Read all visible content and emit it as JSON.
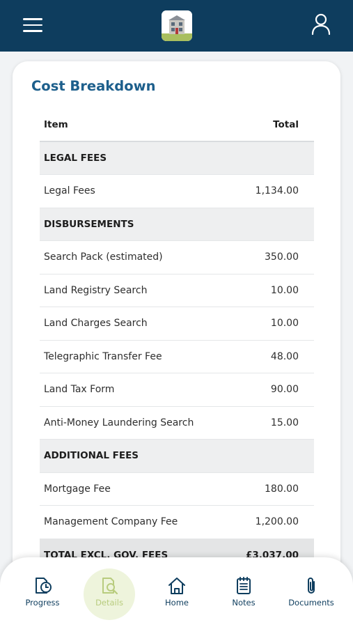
{
  "card": {
    "title": "Cost Breakdown"
  },
  "table": {
    "header": {
      "item": "Item",
      "total": "Total"
    },
    "rows": [
      {
        "type": "section",
        "label": "LEGAL FEES",
        "value": ""
      },
      {
        "type": "item",
        "label": "Legal Fees",
        "value": "1,134.00"
      },
      {
        "type": "section",
        "label": "DISBURSEMENTS",
        "value": ""
      },
      {
        "type": "item",
        "label": "Search Pack (estimated)",
        "value": "350.00"
      },
      {
        "type": "item",
        "label": "Land Registry Search",
        "value": "10.00"
      },
      {
        "type": "item",
        "label": "Land Charges Search",
        "value": "10.00"
      },
      {
        "type": "item",
        "label": "Telegraphic Transfer Fee",
        "value": "48.00"
      },
      {
        "type": "item",
        "label": "Land Tax Form",
        "value": "90.00"
      },
      {
        "type": "item",
        "label": "Anti-Money Laundering Search",
        "value": "15.00"
      },
      {
        "type": "section",
        "label": "ADDITIONAL FEES",
        "value": ""
      },
      {
        "type": "item",
        "label": "Mortgage Fee",
        "value": "180.00"
      },
      {
        "type": "item",
        "label": "Management Company Fee",
        "value": "1,200.00"
      },
      {
        "type": "total",
        "label": "TOTAL EXCL. GOV. FEES",
        "value": "£3,037.00"
      }
    ]
  },
  "nav": {
    "items": [
      {
        "label": "Progress",
        "icon": "progress-clock-icon"
      },
      {
        "label": "Details",
        "icon": "details-search-icon",
        "active": true
      },
      {
        "label": "Home",
        "icon": "home-icon"
      },
      {
        "label": "Notes",
        "icon": "notes-notepad-icon"
      },
      {
        "label": "Documents",
        "icon": "paperclip-icon"
      }
    ]
  },
  "colors": {
    "header": "#0e3d5e",
    "title": "#1d5f8c",
    "active_nav": "#b8cc7e",
    "active_bubble": "#eef4dc"
  }
}
